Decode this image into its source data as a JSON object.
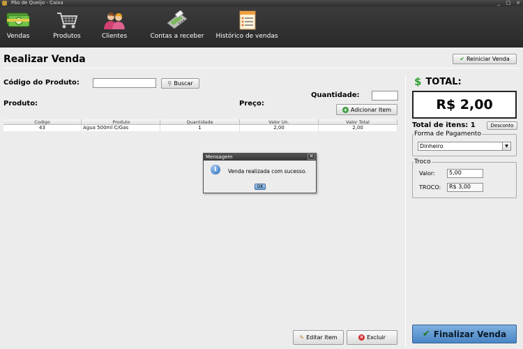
{
  "window": {
    "title": "Pão de Queijo - Caixa",
    "controls": [
      "_",
      "□",
      "×"
    ]
  },
  "toolbar": {
    "items": [
      {
        "label": "Vendas",
        "icon": "cash-icon"
      },
      {
        "label": "Produtos",
        "icon": "shopping-cart-icon"
      },
      {
        "label": "Clientes",
        "icon": "customers-icon"
      },
      {
        "label": "Contas a receber",
        "icon": "card-terminal-icon"
      },
      {
        "label": "Histórico de vendas",
        "icon": "document-icon"
      }
    ]
  },
  "page": {
    "title": "Realizar Venda",
    "reset_button": "Reiniciar Venda"
  },
  "search": {
    "code_label": "Código do Produto:",
    "code_value": "",
    "search_button": "Buscar",
    "quantity_label": "Quantidade:",
    "quantity_value": "",
    "product_label": "Produto:",
    "price_label": "Preço:",
    "add_button": "Adicionar Item"
  },
  "table": {
    "columns": [
      "Codigo",
      "Produto",
      "Quantidade",
      "Valor Un.",
      "Valor Total"
    ],
    "rows": [
      [
        "43",
        "Agua  500ml C/Gas",
        "1",
        "2,00",
        "2,00"
      ]
    ]
  },
  "actions": {
    "edit_button": "Editar Item",
    "delete_button": "Excluir"
  },
  "summary": {
    "total_label": "TOTAL:",
    "total_value": "R$ 2,00",
    "items_label": "Total de itens: 1",
    "discount_button": "Desconto",
    "payment_group": "Forma de Pagamento",
    "payment_selected": "Dinheiro",
    "change_group": "Troco",
    "value_label": "Valor:",
    "value_input": "5,00",
    "change_label": "TROCO:",
    "change_value": "R$ 3,00",
    "finalize_button": "Finalizar Venda"
  },
  "dialog": {
    "title": "Mensagem",
    "message": "Venda realizada com sucesso.",
    "ok_button": "OK"
  },
  "colors": {
    "toolbar_bg": "#2e2e2e",
    "total_dollar": "#2e9e2e",
    "finalize_bg": "#4a86c5"
  }
}
